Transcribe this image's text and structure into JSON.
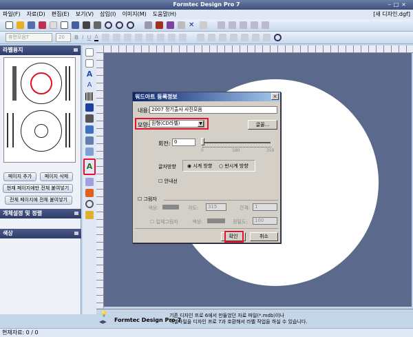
{
  "window": {
    "title": "Formtec Design Pro 7",
    "doc_title": "[새 디자인.dgf]",
    "controls": [
      "–",
      "□",
      "×"
    ]
  },
  "menu": [
    "파일(F)",
    "자료(D)",
    "편집(E)",
    "보기(V)",
    "삽입(I)",
    "이미지(M)",
    "도움말(H)"
  ],
  "format_bar": {
    "font": "휴먼모음T",
    "size": "20",
    "styles": [
      "B",
      "I",
      "U",
      "A"
    ]
  },
  "left_panel": {
    "label_header": "라벨용지",
    "buttons": {
      "add_page": "페이지 추가",
      "delete_page": "페이지 삭제",
      "paste_current": "현재 페이지에만 전체 붙여넣기",
      "paste_all": "전체 페이지에 전체 붙여넣기"
    },
    "object_header": "개체설정 및 정렬",
    "color_header": "색상"
  },
  "dialog": {
    "title": "워드아트 등록정보",
    "content_label": "내용:",
    "content_value": "2007 정기출사 사진모음",
    "shape_label": "모양:",
    "shape_value": "원형(CD라벨)",
    "font_button": "글꼴...",
    "rotation_label": "회전:",
    "rotation_value": "0",
    "slider_ticks": [
      "0",
      "180",
      "359"
    ],
    "direction_label": "글자방향",
    "clockwise": "시계 방향",
    "counterclockwise": "반시계 방향",
    "guide_label": "안내선",
    "shadow_label": "그림자",
    "shadow_color_label": "색상:",
    "angle_label": "각도:",
    "angle_value": "315",
    "spacing_label": "간격:",
    "spacing_value": "1",
    "solid_shadow_label": "입체그림자",
    "solid_color_label": "색상:",
    "opacity_label": "정밀도:",
    "opacity_value": "100",
    "ok": "확인",
    "cancel": "취소"
  },
  "message": {
    "product": "Formtec Design Pro 7",
    "line1": "기존 디자인 프로 6에서 만들었던 자료 파일(*.mdb)이나",
    "line2": "엑셀파일을 디자인 프로 7과 호환해서 라벨 작업을 하실 수 있습니다."
  },
  "status": "현재자료: 0 / 0"
}
